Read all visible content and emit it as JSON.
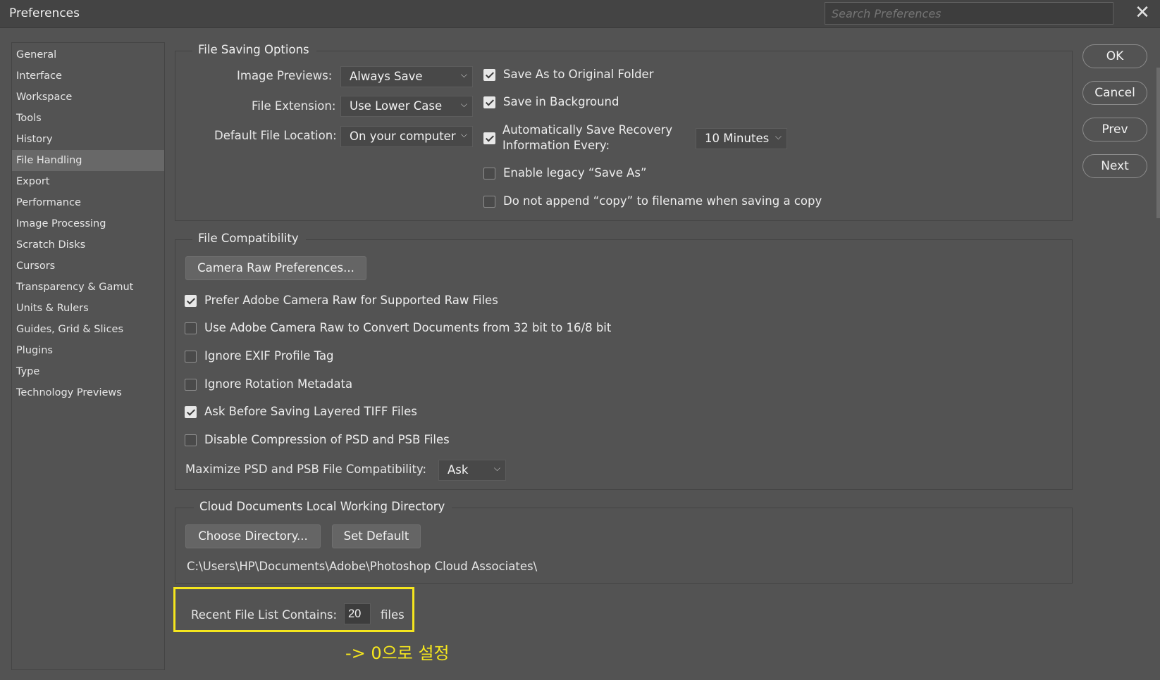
{
  "window": {
    "title": "Preferences",
    "search_placeholder": "Search Preferences",
    "close_glyph": "✕"
  },
  "sidebar": {
    "items": [
      {
        "label": "General"
      },
      {
        "label": "Interface"
      },
      {
        "label": "Workspace"
      },
      {
        "label": "Tools"
      },
      {
        "label": "History"
      },
      {
        "label": "File Handling",
        "active": true
      },
      {
        "label": "Export"
      },
      {
        "label": "Performance"
      },
      {
        "label": "Image Processing"
      },
      {
        "label": "Scratch Disks"
      },
      {
        "label": "Cursors"
      },
      {
        "label": "Transparency & Gamut"
      },
      {
        "label": "Units & Rulers"
      },
      {
        "label": "Guides, Grid & Slices"
      },
      {
        "label": "Plugins"
      },
      {
        "label": "Type"
      },
      {
        "label": "Technology Previews"
      }
    ]
  },
  "file_saving": {
    "legend": "File Saving Options",
    "image_previews_label": "Image Previews:",
    "image_previews_value": "Always Save",
    "file_extension_label": "File Extension:",
    "file_extension_value": "Use Lower Case",
    "default_location_label": "Default File Location:",
    "default_location_value": "On your computer",
    "save_original_folder": {
      "label": "Save As to Original Folder",
      "checked": true
    },
    "save_background": {
      "label": "Save in Background",
      "checked": true
    },
    "auto_recovery": {
      "label_line1": "Automatically Save Recovery",
      "label_line2": "Information Every:",
      "checked": true
    },
    "auto_recovery_interval": "10 Minutes",
    "legacy_save_as": {
      "label": "Enable legacy “Save As”",
      "checked": false
    },
    "no_copy_suffix": {
      "label": "Do not append “copy” to filename when saving a copy",
      "checked": false
    }
  },
  "compatibility": {
    "legend": "File Compatibility",
    "camera_raw_button": "Camera Raw Preferences...",
    "options": [
      {
        "label": "Prefer Adobe Camera Raw for Supported Raw Files",
        "checked": true
      },
      {
        "label": "Use Adobe Camera Raw to Convert Documents from 32 bit to 16/8 bit",
        "checked": false
      },
      {
        "label": "Ignore EXIF Profile Tag",
        "checked": false
      },
      {
        "label": "Ignore Rotation Metadata",
        "checked": false
      },
      {
        "label": "Ask Before Saving Layered TIFF Files",
        "checked": true
      },
      {
        "label": "Disable Compression of PSD and PSB Files",
        "checked": false
      }
    ],
    "maximize_label": "Maximize PSD and PSB File Compatibility:",
    "maximize_value": "Ask"
  },
  "cloud": {
    "legend": "Cloud Documents Local Working Directory",
    "choose_button": "Choose Directory...",
    "default_button": "Set Default",
    "path": "C:\\Users\\HP\\Documents\\Adobe\\Photoshop Cloud Associates\\"
  },
  "recent": {
    "label": "Recent File List Contains:",
    "value": "20",
    "suffix": "files"
  },
  "annotation": {
    "text": "-> 0으로 설정",
    "color": "#f5e61e"
  },
  "actions": {
    "ok": "OK",
    "cancel": "Cancel",
    "prev": "Prev",
    "next": "Next"
  },
  "chevron_glyph": "⌵"
}
